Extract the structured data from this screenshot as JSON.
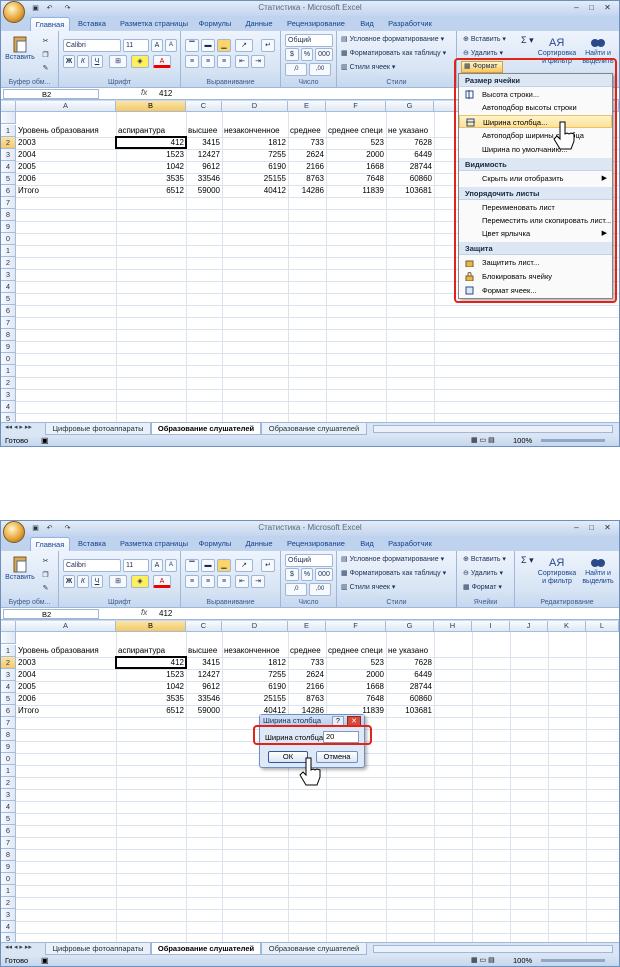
{
  "window": {
    "title": "Статистика - Microsoft Excel"
  },
  "tabs": [
    "Главная",
    "Вставка",
    "Разметка страницы",
    "Формулы",
    "Данные",
    "Рецензирование",
    "Вид",
    "Разработчик"
  ],
  "ribbon": {
    "paste": "Вставить",
    "font_name": "Calibri",
    "font_size": "11",
    "number_format": "Общий",
    "cond_format": "Условное форматирование",
    "format_table": "Форматировать как таблицу",
    "cell_styles": "Стили ячеек",
    "insert": "Вставить",
    "delete": "Удалить",
    "format": "Формат",
    "sigma": "Σ",
    "sort_filter_1": "Сортировка",
    "sort_filter_2": "и фильтр",
    "find_select_1": "Найти и",
    "find_select_2": "выделить",
    "groups": [
      "Буфер обм...",
      "Шрифт",
      "Выравнивание",
      "Число",
      "Стили",
      "Ячейки",
      "Редактирование"
    ],
    "pct": "%",
    "thousands": "000",
    "font_grow": "A",
    "font_shrink": "A",
    "font_color": "A",
    "bold": "Ж",
    "italic": "К",
    "underline": "Ч"
  },
  "formula_bar": {
    "cell_ref": "B2",
    "fx": "fx",
    "value": "412"
  },
  "columns": [
    "A",
    "B",
    "C",
    "D",
    "E",
    "F",
    "G",
    "H",
    "I",
    "J",
    "K",
    "L"
  ],
  "rows": [
    "1",
    "2",
    "3",
    "4",
    "5",
    "6",
    "7",
    "8",
    "9",
    "10",
    "11",
    "12",
    "13",
    "14",
    "15",
    "16",
    "17",
    "18",
    "19",
    "20",
    "21",
    "22",
    "23",
    "24",
    "25",
    "26"
  ],
  "rows_display": [
    "1",
    "2",
    "3",
    "4",
    "5",
    "6",
    "7",
    "8",
    "9",
    "0",
    "1",
    "2",
    "3",
    "4",
    "5",
    "6",
    "7",
    "8",
    "9",
    "0",
    "1",
    "2",
    "3",
    "4",
    "5",
    "6"
  ],
  "table": {
    "headers": [
      "Уровень образования",
      "аспирантура",
      "высшее",
      "незаконченное",
      "среднее",
      "среднее специ",
      "не указано"
    ],
    "data": [
      [
        "2003",
        "412",
        "3415",
        "1812",
        "733",
        "523",
        "7628"
      ],
      [
        "2004",
        "1523",
        "12427",
        "7255",
        "2624",
        "2000",
        "6449"
      ],
      [
        "2005",
        "1042",
        "9612",
        "6190",
        "2166",
        "1668",
        "28744"
      ],
      [
        "2006",
        "3535",
        "33546",
        "25155",
        "8763",
        "7648",
        "60860"
      ],
      [
        "Итого",
        "6512",
        "59000",
        "40412",
        "14286",
        "11839",
        "103681"
      ]
    ]
  },
  "sheets": [
    "Цифровые фотоаппараты",
    "Образование слушателей",
    "Образование слушателей"
  ],
  "status": {
    "ready": "Готово",
    "zoom": "100%"
  },
  "format_menu": {
    "section_cell_size": "Размер ячейки",
    "row_height": "Высота строки...",
    "autofit_row": "Автоподбор высоты строки",
    "column_width": "Ширина столбца...",
    "autofit_column": "Автоподбор ширины столбца",
    "default_width": "Ширина по умолчанию...",
    "section_visibility": "Видимость",
    "hide_show": "Скрыть или отобразить",
    "section_organize": "Упорядочить листы",
    "rename_sheet": "Переименовать лист",
    "move_copy": "Переместить или скопировать лист...",
    "tab_color": "Цвет ярлычка",
    "section_protection": "Защита",
    "protect_sheet": "Защитить лист...",
    "lock_cell": "Блокировать ячейку",
    "format_cells": "Формат ячеек..."
  },
  "dialog": {
    "title": "Ширина столбца",
    "label": "Ширина столбца:",
    "value": "20",
    "ok": "ОК",
    "cancel": "Отмена",
    "help": "?",
    "close": "✕"
  },
  "icons": {
    "office": "office-button-icon",
    "save": "save-icon",
    "undo": "undo-icon",
    "redo": "redo-icon",
    "cursor": "mouse-cursor-icon"
  },
  "colors": {
    "highlight_red": "#e2231a",
    "menu_hover": "#fde197",
    "selected_header": "#f5c967"
  }
}
